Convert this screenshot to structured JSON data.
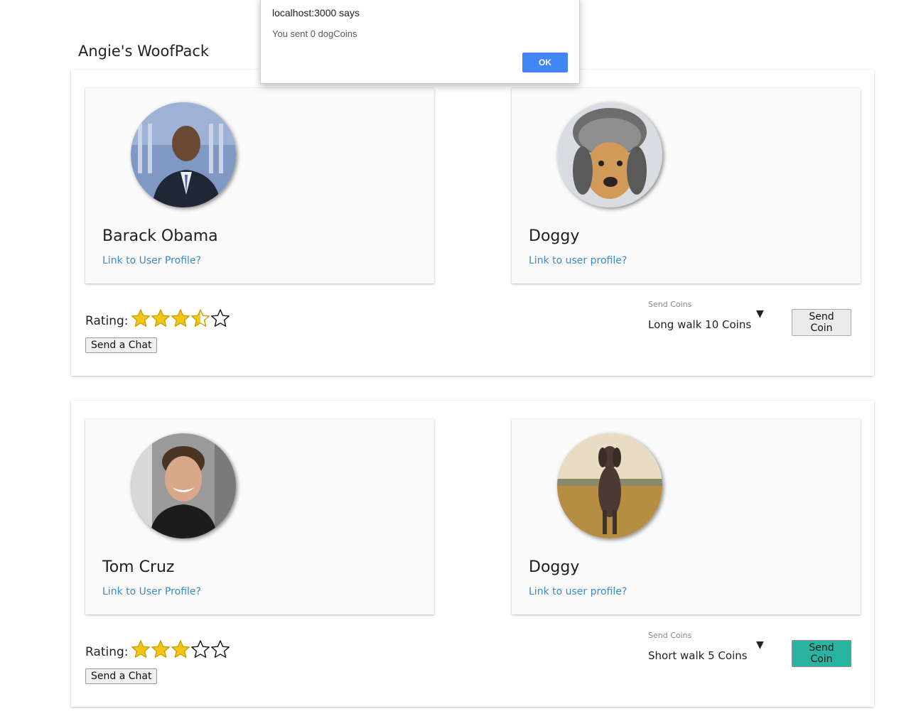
{
  "dialog": {
    "title": "localhost:3000 says",
    "message": "You sent 0 dogCoins",
    "ok_label": "OK"
  },
  "page": {
    "title": "Angie's WoofPack"
  },
  "pairs": [
    {
      "human": {
        "name": "Barack Obama",
        "link": "Link to User Profile?",
        "avatar": "avatar-photo-icon"
      },
      "dog": {
        "name": "Doggy",
        "link": "Link to user profile?",
        "avatar": "dog-photo-icon"
      },
      "rating_label": "Rating:",
      "rating": 3.5,
      "chat_label": "Send a Chat",
      "send_coins_label": "Send Coins",
      "selected_option": "Long walk 10 Coins",
      "send_button_label": "Send Coin",
      "send_button_active": false
    },
    {
      "human": {
        "name": "Tom Cruz",
        "link": "Link to User Profile?",
        "avatar": "avatar-photo-icon"
      },
      "dog": {
        "name": "Doggy",
        "link": "Link to user profile?",
        "avatar": "dog-photo-icon"
      },
      "rating_label": "Rating:",
      "rating": 3,
      "chat_label": "Send a Chat",
      "send_coins_label": "Send Coins",
      "selected_option": "Short walk 5 Coins",
      "send_button_label": "Send Coin",
      "send_button_active": true
    }
  ],
  "colors": {
    "link": "#3a8bc6",
    "star_fill": "#f5c518",
    "send_active": "#2ab3a0",
    "dialog_ok": "#4285f4"
  }
}
